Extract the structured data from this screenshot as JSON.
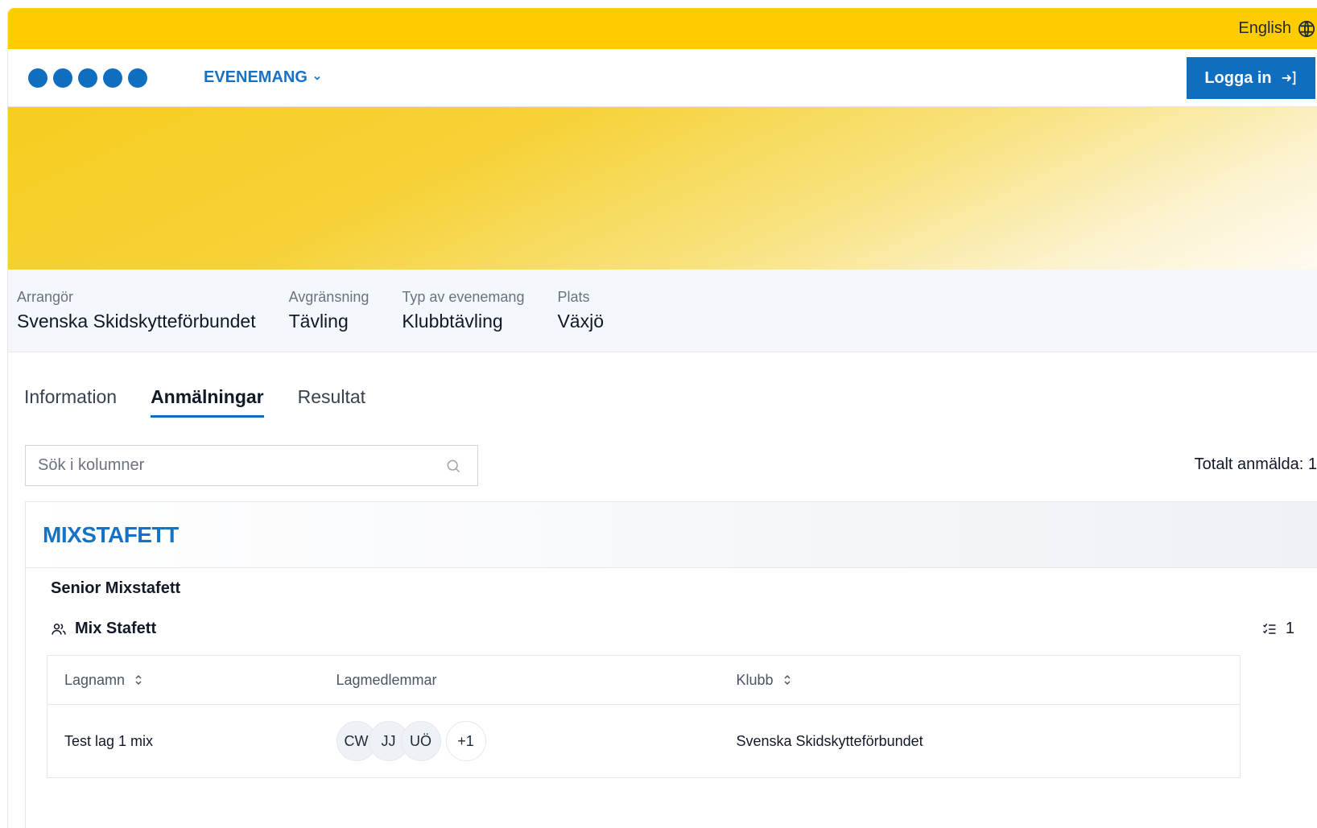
{
  "topbar": {
    "language_label": "English",
    "language_icon": "globe-icon"
  },
  "header": {
    "nav_label": "EVENEMANG",
    "login_label": "Logga in",
    "brand_color": "#0f6ebf"
  },
  "info": [
    {
      "label": "Arrangör",
      "value": "Svenska Skidskytteförbundet"
    },
    {
      "label": "Avgränsning",
      "value": "Tävling"
    },
    {
      "label": "Typ av evenemang",
      "value": "Klubbtävling"
    },
    {
      "label": "Plats",
      "value": "Växjö"
    }
  ],
  "tabs": [
    {
      "label": "Information",
      "active": false
    },
    {
      "label": "Anmälningar",
      "active": true
    },
    {
      "label": "Resultat",
      "active": false
    }
  ],
  "search": {
    "placeholder": "Sök i kolumner"
  },
  "total_label": "Totalt anmälda: 1",
  "section": {
    "title": "MIXSTAFETT",
    "class_name": "Senior Mixstafett",
    "team_type": "Mix Stafett",
    "count": "1"
  },
  "table": {
    "headers": [
      "Lagnamn",
      "Lagmedlemmar",
      "Klubb"
    ],
    "rows": [
      {
        "team_name": "Test lag 1 mix",
        "members": [
          "CW",
          "JJ",
          "UÖ"
        ],
        "more": "+1",
        "club": "Svenska Skidskytteförbundet"
      }
    ]
  }
}
